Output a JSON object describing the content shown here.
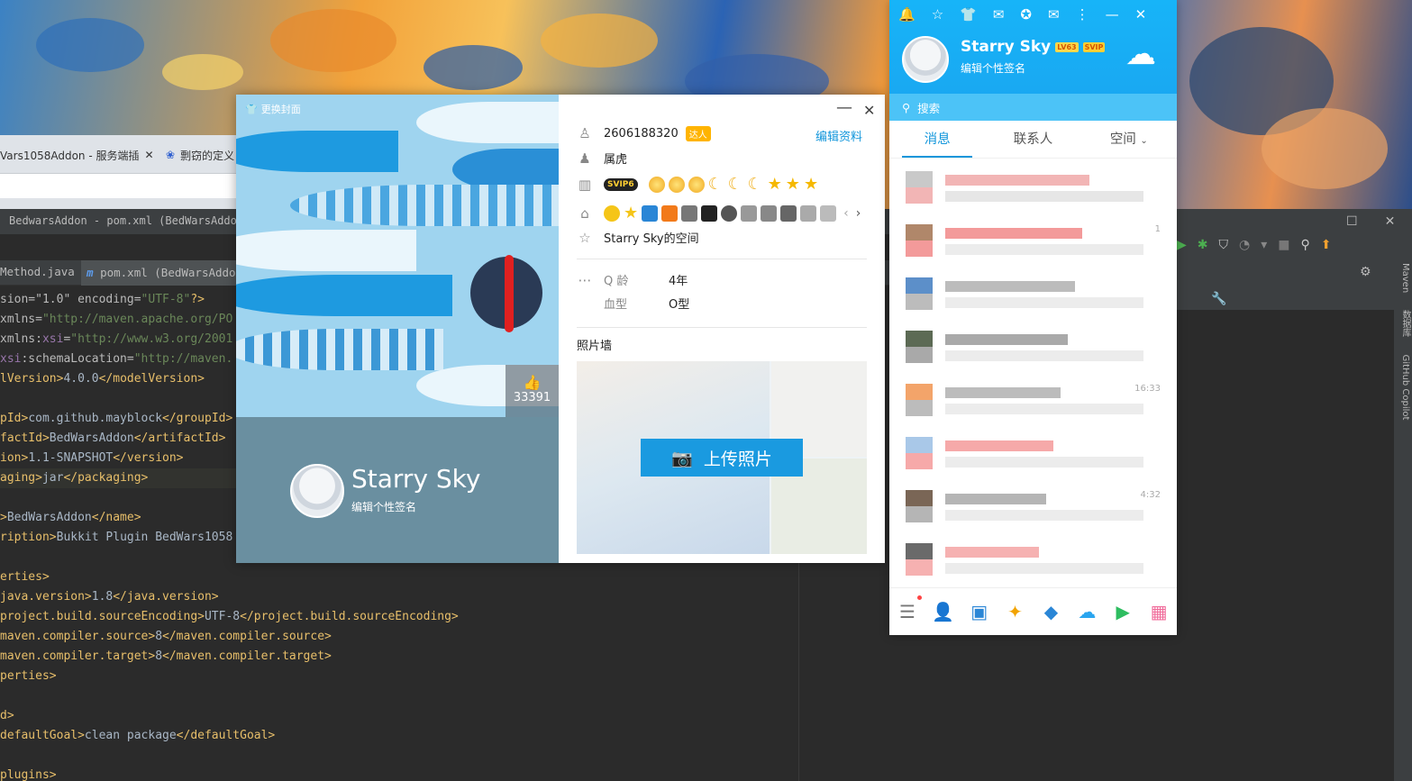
{
  "browser": {
    "tab1_label": "Vars1058Addon - 服务端插",
    "tab2_label": "剽窃的定义"
  },
  "ide": {
    "title": "BedwarsAddon - pom.xml (BedWarsAddon",
    "tabs": [
      "Method.java",
      "pom.xml (BedWarsAddo"
    ],
    "right_sidebar": [
      "Maven",
      "数据库",
      "GitHub Copilot"
    ],
    "code_lines": [
      [
        {
          "t": "sion=\"1.0\" ",
          "c": "at"
        },
        {
          "t": "encoding=",
          "c": "at"
        },
        {
          "t": "\"UTF-8\"",
          "c": "st"
        },
        {
          "t": "?>",
          "c": "tg"
        }
      ],
      [
        {
          "t": "xmlns=",
          "c": "at"
        },
        {
          "t": "\"http://maven.apache.org/PO",
          "c": "st"
        }
      ],
      [
        {
          "t": "xmlns:",
          "c": "at"
        },
        {
          "t": "xsi",
          "c": "ns"
        },
        {
          "t": "=",
          "c": "at"
        },
        {
          "t": "\"http://www.w3.org/2001",
          "c": "st"
        }
      ],
      [
        {
          "t": "xsi",
          "c": "ns"
        },
        {
          "t": ":schemaLocation=",
          "c": "at"
        },
        {
          "t": "\"http://maven.",
          "c": "st"
        }
      ],
      [
        {
          "t": "lVersion>",
          "c": "tg"
        },
        {
          "t": "4.0.0",
          "c": ""
        },
        {
          "t": "</modelVersion>",
          "c": "tg"
        }
      ],
      [],
      [
        {
          "t": "pId>",
          "c": "tg"
        },
        {
          "t": "com.github.mayblock",
          "c": ""
        },
        {
          "t": "</groupId>",
          "c": "tg"
        }
      ],
      [
        {
          "t": "factId>",
          "c": "tg"
        },
        {
          "t": "BedWarsAddon",
          "c": ""
        },
        {
          "t": "</artifactId>",
          "c": "tg"
        }
      ],
      [
        {
          "t": "ion>",
          "c": "tg"
        },
        {
          "t": "1.1-SNAPSHOT",
          "c": ""
        },
        {
          "t": "</version>",
          "c": "tg"
        }
      ],
      [
        {
          "t": "aging>",
          "c": "tg"
        },
        {
          "t": "jar",
          "c": ""
        },
        {
          "t": "</packaging>",
          "c": "tg"
        }
      ],
      [],
      [
        {
          "t": ">",
          "c": "tg"
        },
        {
          "t": "BedWarsAddon",
          "c": ""
        },
        {
          "t": "</name>",
          "c": "tg"
        }
      ],
      [
        {
          "t": "ription>",
          "c": "tg"
        },
        {
          "t": "Bukkit Plugin BedWars1058",
          "c": ""
        }
      ],
      [],
      [
        {
          "t": "erties>",
          "c": "tg"
        }
      ],
      [
        {
          "t": "java.version>",
          "c": "tg"
        },
        {
          "t": "1.8",
          "c": ""
        },
        {
          "t": "</java.version>",
          "c": "tg"
        }
      ],
      [
        {
          "t": "project.build.sourceEncoding>",
          "c": "tg"
        },
        {
          "t": "UTF-8",
          "c": ""
        },
        {
          "t": "</project.build.sourceEncoding>",
          "c": "tg"
        }
      ],
      [
        {
          "t": "maven.compiler.source>",
          "c": "tg"
        },
        {
          "t": "8",
          "c": ""
        },
        {
          "t": "</maven.compiler.source>",
          "c": "tg"
        }
      ],
      [
        {
          "t": "maven.compiler.target>",
          "c": "tg"
        },
        {
          "t": "8",
          "c": ""
        },
        {
          "t": "</maven.compiler.target>",
          "c": "tg"
        }
      ],
      [
        {
          "t": "perties>",
          "c": "tg"
        }
      ],
      [],
      [
        {
          "t": "d>",
          "c": "tg"
        }
      ],
      [
        {
          "t": "defaultGoal>",
          "c": "tg"
        },
        {
          "t": "clean package",
          "c": ""
        },
        {
          "t": "</defaultGoal>",
          "c": "tg"
        }
      ],
      [],
      [
        {
          "t": "plugins>",
          "c": "tg"
        }
      ]
    ]
  },
  "profile_card": {
    "change_cover": "更换封面",
    "likes": "33391",
    "name": "Starry Sky",
    "signature": "编辑个性签名",
    "qq_number": "2606188320",
    "talent_badge": "达人",
    "edit_profile": "编辑资料",
    "zodiac": "属虎",
    "svip_label": "SVIP6",
    "space": "Starry Sky的空间",
    "q_age_label": "Q 龄",
    "q_age_value": "4年",
    "blood_label": "血型",
    "blood_value": "O型",
    "photo_wall_title": "照片墙",
    "upload_button": "上传照片"
  },
  "qq_main": {
    "name": "Starry Sky",
    "level_badge": "LV63",
    "svip_badge": "SVIP",
    "signature": "编辑个性签名",
    "search_placeholder": "搜索",
    "tabs": [
      "消息",
      "联系人",
      "空间"
    ],
    "times": [
      "",
      "1",
      "",
      "",
      "16:33",
      "",
      "4:32",
      ""
    ]
  },
  "colors": {
    "qq_blue": "#1aa5f0",
    "accent": "#1296db",
    "upload": "#1a9ae0",
    "ide_bg": "#2b2b2b"
  }
}
